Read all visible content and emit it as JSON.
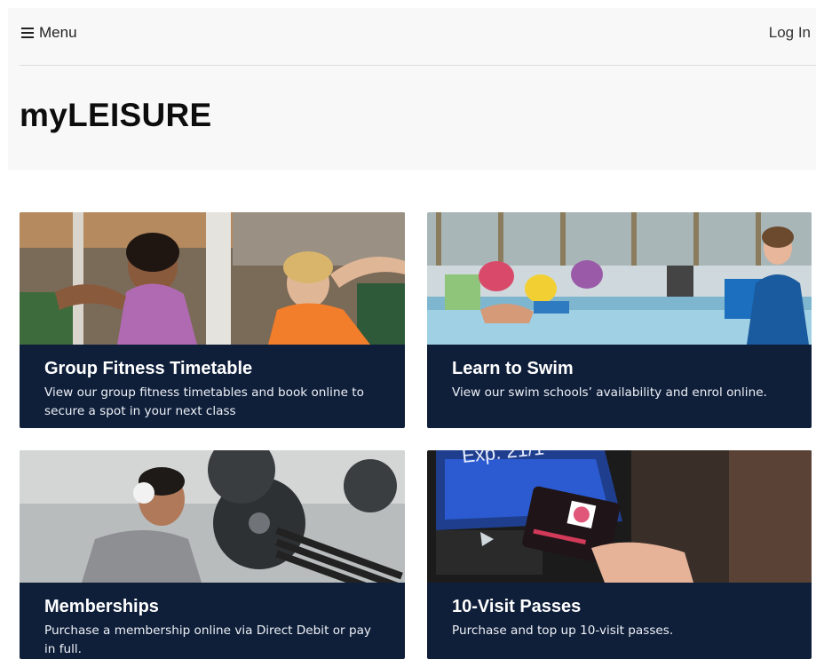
{
  "header": {
    "menu_label": "Menu",
    "login_label": "Log In",
    "brand": "myLEISURE"
  },
  "cards": [
    {
      "title": "Group Fitness Timetable",
      "description": "View our group fitness timetables and book online to secure a spot in your next class",
      "image": "group-fitness-photo"
    },
    {
      "title": "Learn to Swim",
      "description": "View our swim schools’ availability and enrol online.",
      "image": "swim-lesson-photo"
    },
    {
      "title": "Memberships",
      "description": "Purchase a membership online via Direct Debit or pay in full.",
      "image": "gym-weights-photo"
    },
    {
      "title": "10-Visit Passes",
      "description": "Purchase and top up 10-visit passes.",
      "image": "access-card-photo"
    }
  ],
  "colors": {
    "card_body": "#0f1f3a",
    "header_bg": "#f8f8f8"
  }
}
